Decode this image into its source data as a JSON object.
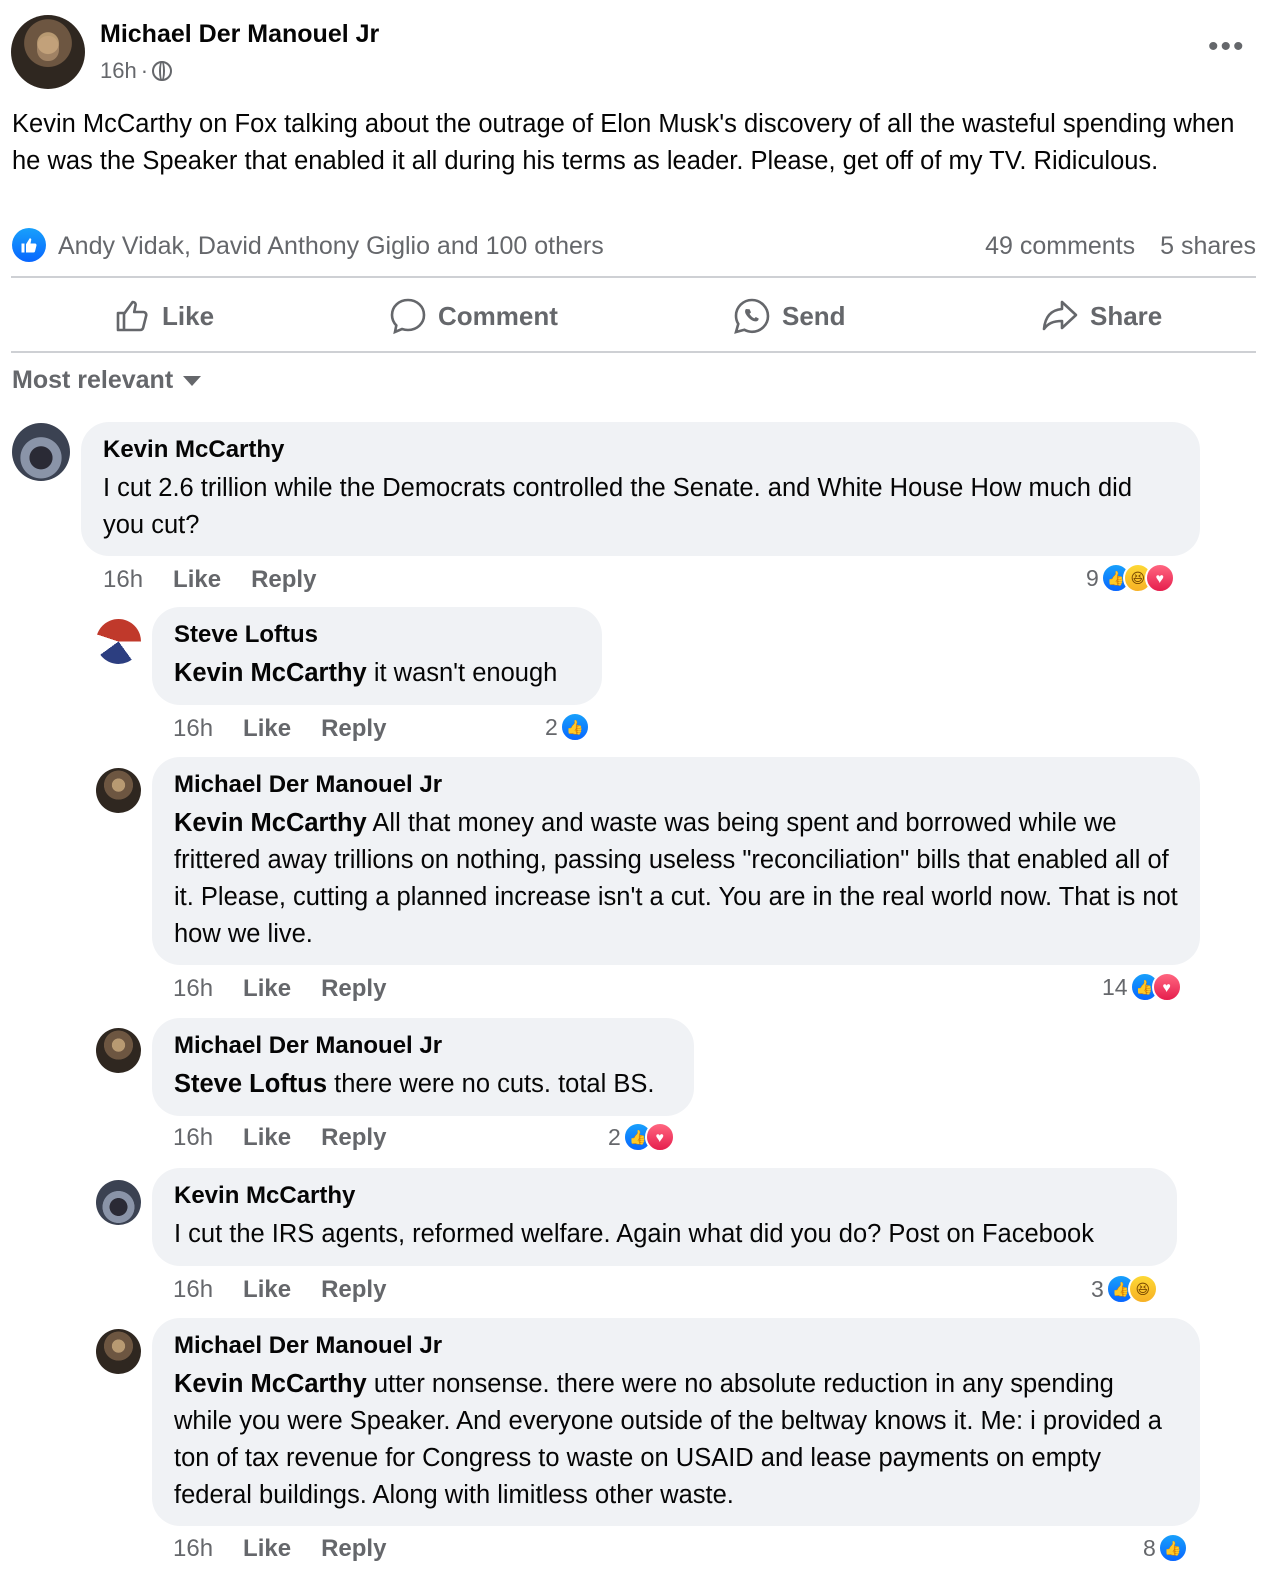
{
  "post": {
    "author": "Michael Der Manouel Jr",
    "time": "16h",
    "visibility_icon": "globe-icon",
    "text": "Kevin McCarthy on Fox talking about the outrage of Elon Musk's discovery of all the wasteful spending when he was the Speaker that enabled it all during his terms as leader.  Please, get off of my TV.  Ridiculous.",
    "reactions_text": "Andy Vidak, David Anthony Giglio and 100 others",
    "comments_count": "49 comments",
    "shares_count": "5 shares"
  },
  "actions": {
    "like": "Like",
    "comment": "Comment",
    "send": "Send",
    "share": "Share"
  },
  "sort_label": "Most relevant",
  "comments": [
    {
      "author": "Kevin McCarthy",
      "mention": "",
      "text": "I cut 2.6 trillion while the Democrats controlled the Senate. and White House How much did you cut?",
      "time": "16h",
      "like": "Like",
      "reply": "Reply",
      "reaction_count": "9",
      "reactions": [
        "like",
        "haha",
        "love"
      ]
    },
    {
      "author": "Steve Loftus",
      "mention": "Kevin McCarthy",
      "text": " it wasn't enough",
      "time": "16h",
      "like": "Like",
      "reply": "Reply",
      "reaction_count": "2",
      "reactions": [
        "like"
      ]
    },
    {
      "author": "Michael Der Manouel Jr",
      "mention": "Kevin McCarthy",
      "text": " All that money and waste was being spent and borrowed while we frittered away trillions on nothing, passing useless \"reconciliation\" bills that enabled all of it. Please, cutting a planned increase isn't a cut. You are in the real world now. That is not how we live.",
      "time": "16h",
      "like": "Like",
      "reply": "Reply",
      "reaction_count": "14",
      "reactions": [
        "like",
        "love"
      ]
    },
    {
      "author": "Michael Der Manouel Jr",
      "mention": "Steve Loftus",
      "text": " there were no cuts. total BS.",
      "time": "16h",
      "like": "Like",
      "reply": "Reply",
      "reaction_count": "2",
      "reactions": [
        "like",
        "love"
      ]
    },
    {
      "author": "Kevin McCarthy",
      "mention": "",
      "text": "I cut the IRS agents, reformed welfare. Again what did you do? Post on Facebook",
      "time": "16h",
      "like": "Like",
      "reply": "Reply",
      "reaction_count": "3",
      "reactions": [
        "like",
        "haha"
      ]
    },
    {
      "author": "Michael Der Manouel Jr",
      "mention": "Kevin McCarthy",
      "text": " utter nonsense. there were no absolute reduction in any spending while you were Speaker. And everyone outside of the beltway knows it. Me: i provided a ton of tax revenue for Congress to waste on USAID and lease payments on empty federal buildings. Along with limitless other waste.",
      "time": "16h",
      "like": "Like",
      "reply": "Reply",
      "reaction_count": "8",
      "reactions": [
        "like"
      ]
    }
  ]
}
